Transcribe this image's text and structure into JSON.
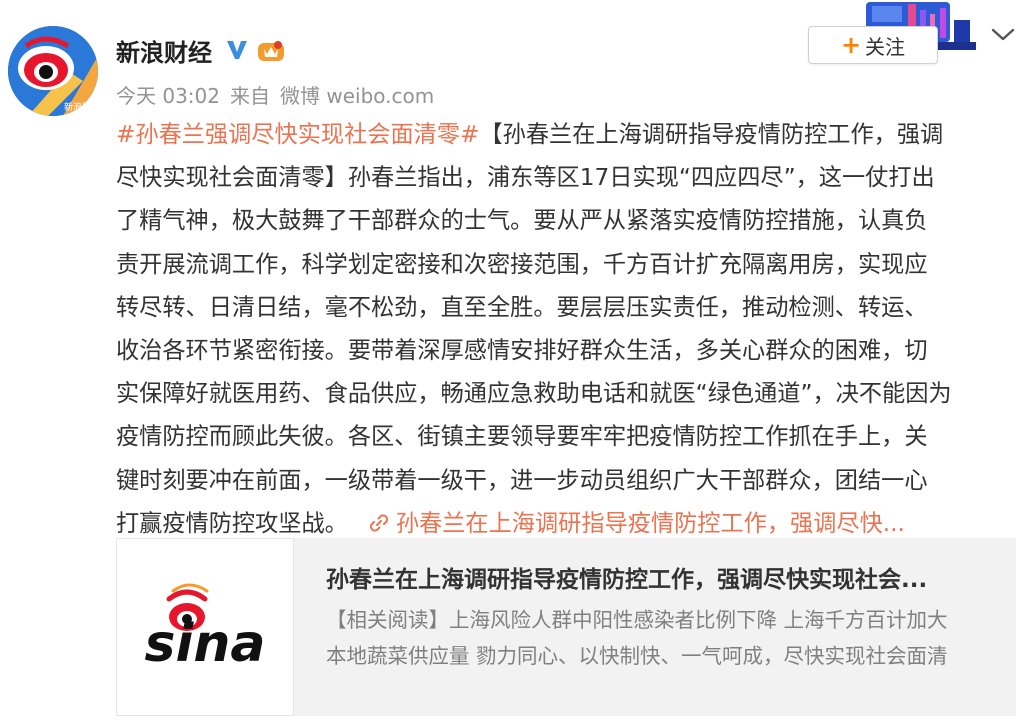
{
  "account": {
    "name": "新浪财经",
    "avatar_icon": "sina-finance-eye-avatar",
    "verified_icon": "verified-v-badge",
    "member_icon": "vip-crown-badge"
  },
  "meta": {
    "time": "今天 03:02",
    "source_prefix": "来自",
    "source": "微博 weibo.com"
  },
  "follow_button": {
    "plus": "+",
    "label": "关注"
  },
  "post": {
    "hashtag": "#孙春兰强调尽快实现社会面清零#",
    "line1_rest": "【孙春兰在上海调研指导疫情防控工作，强调",
    "lines": [
      "尽快实现社会面清零】孙春兰指出，浦东等区17日实现“四应四尽”，这一仗打出",
      "了精气神，极大鼓舞了干部群众的士气。要从严从紧落实疫情防控措施，认真负",
      "责开展流调工作，科学划定密接和次密接范围，千方百计扩充隔离用房，实现应",
      "转尽转、日清日结，毫不松劲，直至全胜。要层层压实责任，推动检测、转运、",
      "收治各环节紧密衔接。要带着深厚感情安排好群众生活，多关心群众的困难，切",
      "实保障好就医用药、食品供应，畅通应急救助电话和就医“绿色通道”，决不能因为",
      "疫情防控而顾此失彼。各区、街镇主要领导要牢牢把疫情防控工作抓在手上，关",
      "键时刻要冲在前面，一级带着一级干，进一步动员组织广大干部群众，团结一心"
    ],
    "last_line": "打赢疫情防控攻坚战。",
    "link_text": "孙春兰在上海调研指导疫情防控工作，强调尽快..."
  },
  "card": {
    "logo_text": "sina",
    "title": "孙春兰在上海调研指导疫情防控工作，强调尽快实现社会...",
    "desc_line1": "【相关阅读】上海风险人群中阳性感染者比例下降 上海千方百计加大",
    "desc_line2": "本地蔬菜供应量 勠力同心、以快制快、一气呵成，尽快实现社会面清"
  },
  "colors": {
    "accent": "#eb7350",
    "follow_plus": "#ff8200",
    "meta_gray": "#939393",
    "card_bg": "#f2f2f2"
  }
}
